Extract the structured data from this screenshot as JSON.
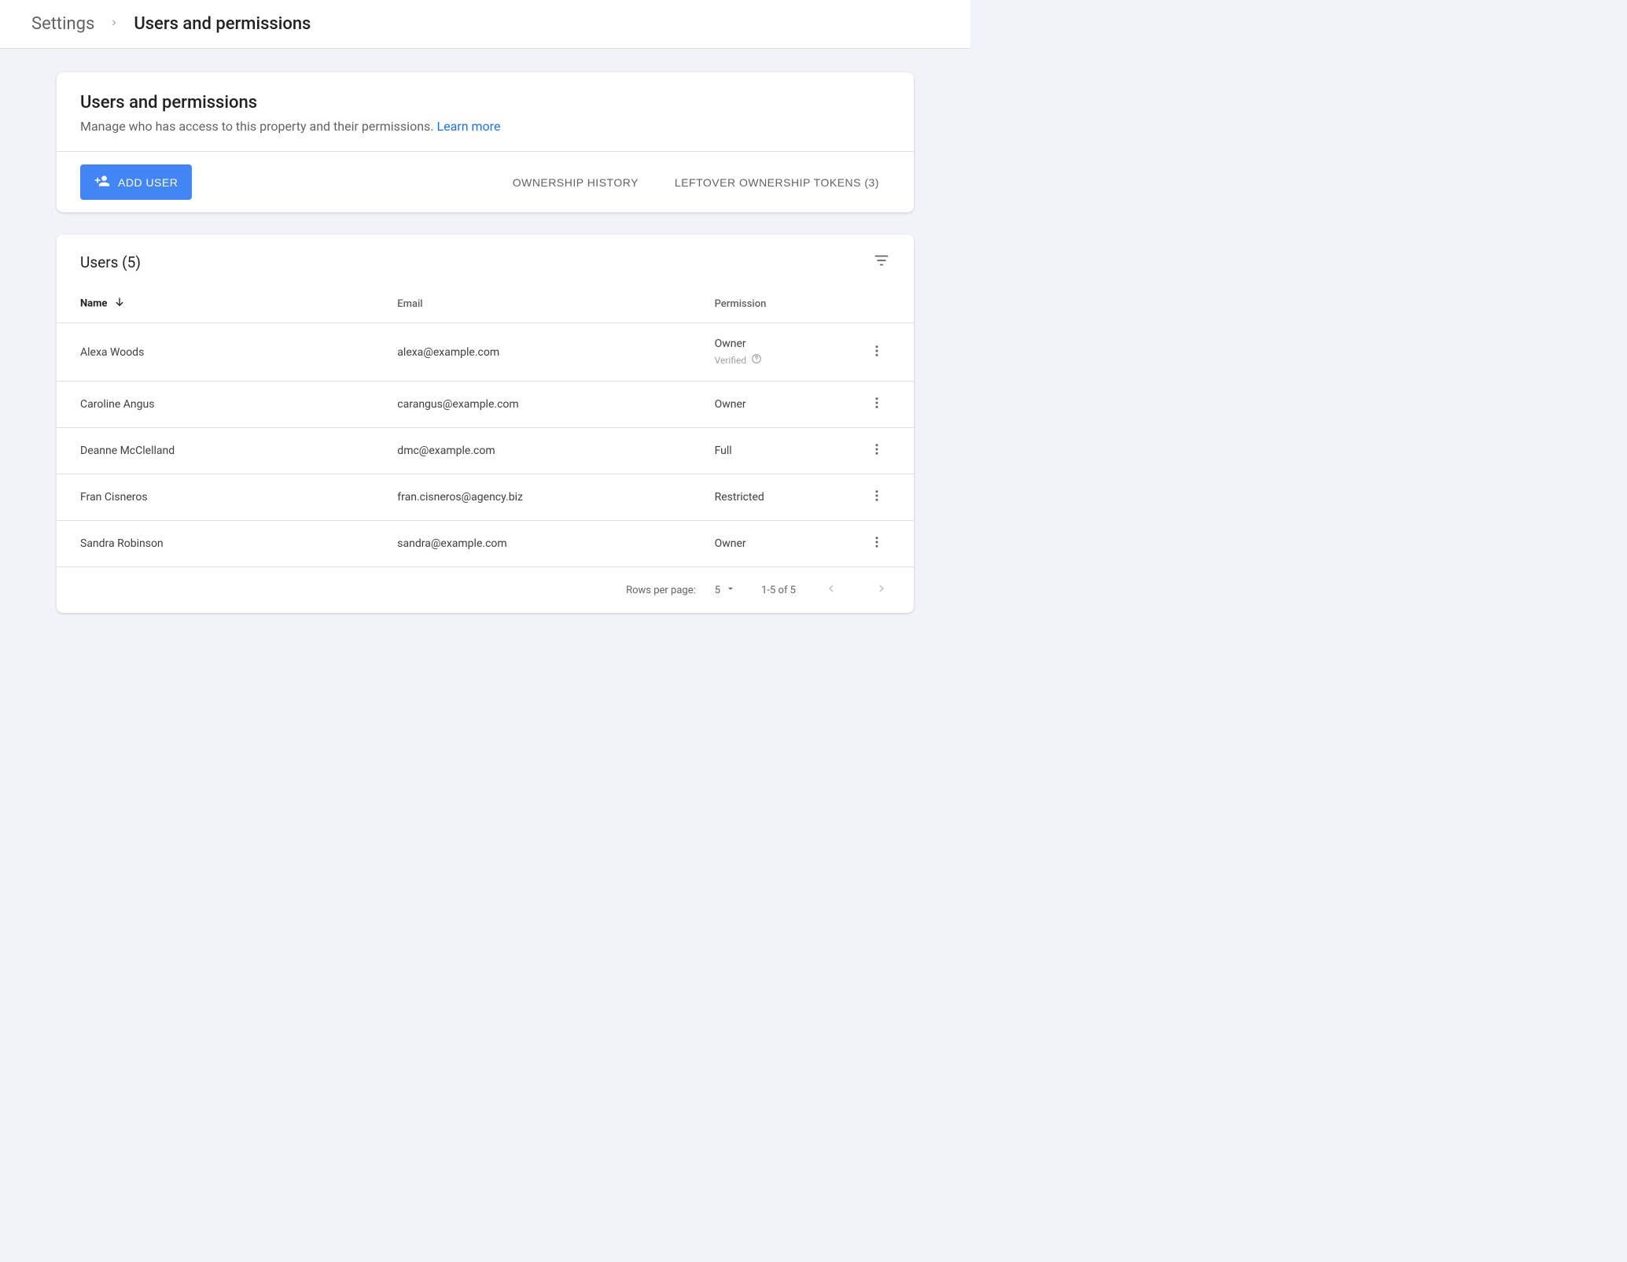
{
  "breadcrumb": {
    "parent": "Settings",
    "current": "Users and permissions"
  },
  "panel": {
    "title": "Users and permissions",
    "subtitle": "Manage who has access to this property and their permissions. ",
    "learn_more": "Learn more"
  },
  "toolbar": {
    "add_user": "ADD USER",
    "ownership_history": "OWNERSHIP HISTORY",
    "leftover_tokens": "LEFTOVER OWNERSHIP TOKENS (3)"
  },
  "table": {
    "title": "Users (5)",
    "columns": {
      "name": "Name",
      "email": "Email",
      "permission": "Permission"
    },
    "rows": [
      {
        "name": "Alexa Woods",
        "email": "alexa@example.com",
        "permission": "Owner",
        "verified": "Verified"
      },
      {
        "name": "Caroline Angus",
        "email": "carangus@example.com",
        "permission": "Owner"
      },
      {
        "name": "Deanne McClelland",
        "email": "dmc@example.com",
        "permission": "Full"
      },
      {
        "name": "Fran Cisneros",
        "email": "fran.cisneros@agency.biz",
        "permission": "Restricted"
      },
      {
        "name": "Sandra Robinson",
        "email": "sandra@example.com",
        "permission": "Owner"
      }
    ]
  },
  "paginator": {
    "rows_per_page_label": "Rows per page:",
    "rows_per_page_value": "5",
    "range": "1-5 of 5"
  }
}
